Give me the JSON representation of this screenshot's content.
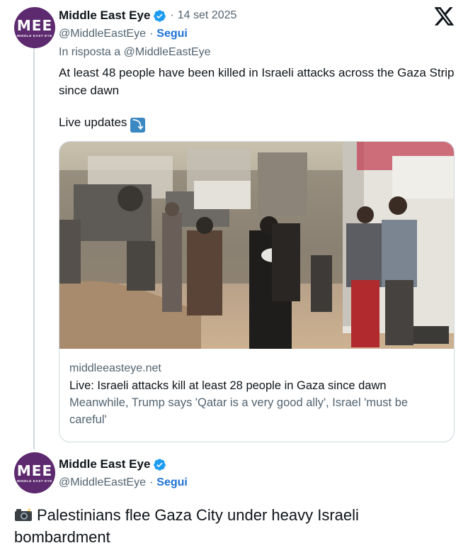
{
  "tweet1": {
    "author": {
      "name": "Middle East Eye",
      "handle": "@MiddleEastEye",
      "follow_label": "Segui",
      "avatar_text": "MEE",
      "avatar_sub": "MIDDLE EAST EYE"
    },
    "date": "14 set 2025",
    "reply_to": "In risposta a @MiddleEastEye",
    "text": "At least 48 people have been killed in Israeli attacks across the Gaza Strip since dawn",
    "live_label": "Live updates",
    "live_icon": "⤵",
    "card": {
      "domain": "middleeasteye.net",
      "title": "Live: Israeli attacks kill at least 28 people in Gaza since dawn",
      "description": "Meanwhile, Trump says 'Qatar is a very good ally', Israel 'must be careful'"
    }
  },
  "tweet2": {
    "author": {
      "name": "Middle East Eye",
      "handle": "@MiddleEastEye",
      "follow_label": "Segui",
      "avatar_text": "MEE",
      "avatar_sub": "MIDDLE EAST EYE"
    },
    "text": "Palestinians flee Gaza City under heavy Israeli bombardment"
  },
  "icons": {
    "verified": "verified-badge-icon",
    "x_logo": "x-logo-icon",
    "camera": "camera-flash-icon"
  },
  "colors": {
    "brand_purple": "#5d2a6f",
    "link_blue": "#1d72d6",
    "verified_blue": "#1d9bf0",
    "muted": "#536471"
  }
}
